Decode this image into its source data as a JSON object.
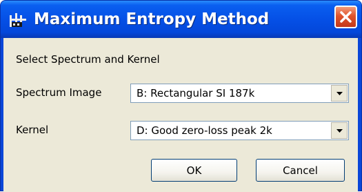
{
  "window": {
    "title": "Maximum Entropy Method",
    "app_icon": "ladder-chart-icon",
    "close_icon": "close-icon"
  },
  "dialog": {
    "heading": "Select Spectrum and Kernel",
    "spectrum": {
      "label": "Spectrum Image",
      "selected": "B: Rectangular SI  187k"
    },
    "kernel": {
      "label": "Kernel",
      "selected": "D: Good zero-loss peak  2k"
    }
  },
  "buttons": {
    "ok": "OK",
    "cancel": "Cancel"
  },
  "colors": {
    "titlebar": "#0550e6",
    "close": "#e0542c",
    "dialog_bg": "#ece9d8",
    "field_border": "#7f9db9"
  }
}
